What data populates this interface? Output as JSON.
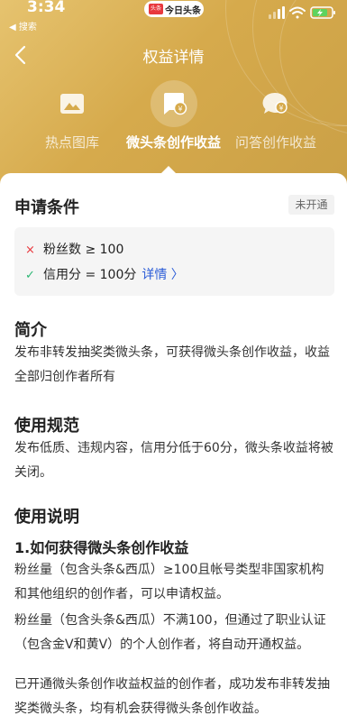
{
  "status_bar": {
    "time": "3:34",
    "back_app": "◀ 搜索",
    "pill_logo": "头条",
    "pill_text": "今日头条"
  },
  "nav": {
    "title": "权益详情",
    "back_icon": "chevron-left-icon"
  },
  "tabs": [
    {
      "label": "热点图库",
      "icon": "image-icon",
      "active": false
    },
    {
      "label": "微头条创作收益",
      "icon": "post-yen-icon",
      "active": true
    },
    {
      "label": "问答创作收益",
      "icon": "chat-yen-icon",
      "active": false
    }
  ],
  "conditions": {
    "title": "申请条件",
    "badge": "未开通",
    "items": [
      {
        "mark": "×",
        "text": "粉丝数 ≥ 100",
        "met": false
      },
      {
        "mark": "✓",
        "text": "信用分 = 100分",
        "met": true,
        "link": "详情 〉"
      }
    ]
  },
  "intro": {
    "title": "简介",
    "body": "发布非转发抽奖类微头条，可获得微头条创作收益，收益全部归创作者所有"
  },
  "rules": {
    "title": "使用规范",
    "body": "发布低质、违规内容，信用分低于60分，微头条收益将被关闭。"
  },
  "guide": {
    "title": "使用说明",
    "subtitle": "1.如何获得微头条创作收益",
    "paragraphs": [
      "粉丝量（包含头条&西瓜）≥100且帐号类型非国家机构和其他组织的创作者，可以申请权益。",
      "粉丝量（包含头条&西瓜）不满100，但通过了职业认证（包含金V和黄V）的个人创作者，将自动开通权益。",
      "已开通微头条创作收益权益的创作者，成功发布非转发抽奖类微头条，均有机会获得微头条创作收益。"
    ]
  },
  "colors": {
    "hero_gold": "#d6aa4c",
    "link_blue": "#2a5bd7",
    "unmet_red": "#e8383d",
    "met_green": "#2bb673"
  }
}
